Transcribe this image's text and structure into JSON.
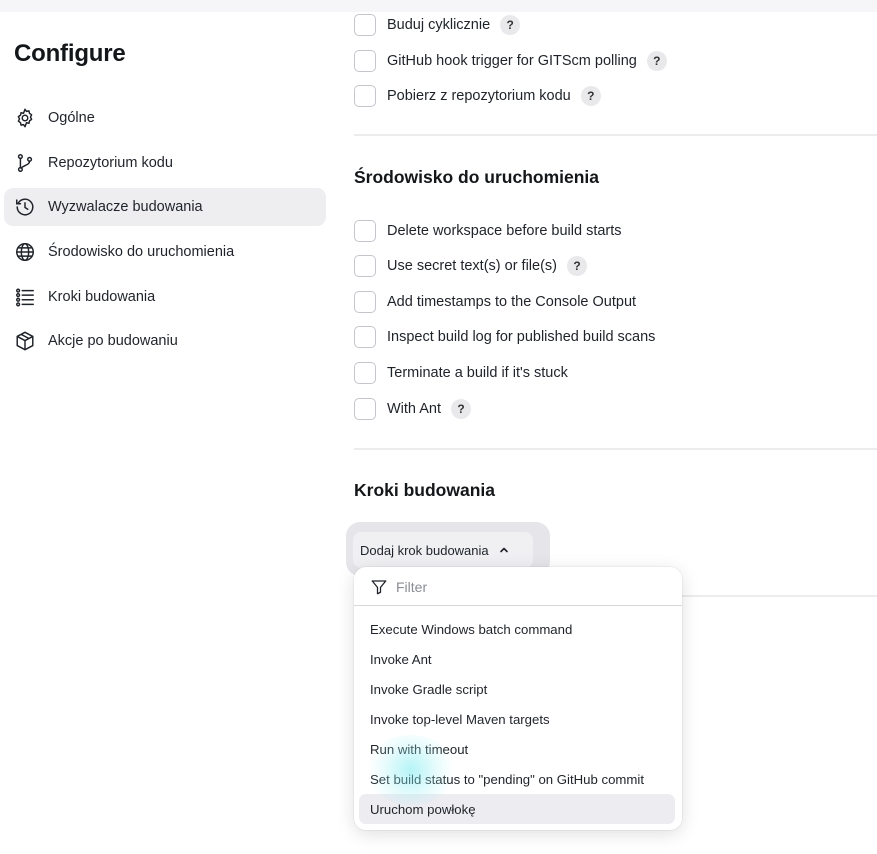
{
  "page_title": "Configure",
  "sidebar": {
    "items": [
      {
        "label": "Ogólne",
        "icon": "gear-icon",
        "active": false
      },
      {
        "label": "Repozytorium kodu",
        "icon": "branch-icon",
        "active": false
      },
      {
        "label": "Wyzwalacze budowania",
        "icon": "clock-icon",
        "active": true
      },
      {
        "label": "Środowisko do uruchomienia",
        "icon": "globe-icon",
        "active": false
      },
      {
        "label": "Kroki budowania",
        "icon": "list-icon",
        "active": false
      },
      {
        "label": "Akcje po budowaniu",
        "icon": "package-icon",
        "active": false
      }
    ]
  },
  "triggers": {
    "options": [
      {
        "label": "Buduj cyklicznie",
        "help": "?"
      },
      {
        "label": "GitHub hook trigger for GITScm polling",
        "help": "?"
      },
      {
        "label": "Pobierz z repozytorium kodu",
        "help": "?"
      }
    ]
  },
  "environment": {
    "title": "Środowisko do uruchomienia",
    "options": [
      {
        "label": "Delete workspace before build starts"
      },
      {
        "label": "Use secret text(s) or file(s)",
        "help": "?"
      },
      {
        "label": "Add timestamps to the Console Output"
      },
      {
        "label": "Inspect build log for published build scans"
      },
      {
        "label": "Terminate a build if it's stuck"
      },
      {
        "label": "With Ant",
        "help": "?"
      }
    ]
  },
  "build_steps": {
    "title": "Kroki budowania",
    "add_button_label": "Dodaj krok budowania"
  },
  "dropdown": {
    "filter_placeholder": "Filter",
    "items": [
      "Execute Windows batch command",
      "Invoke Ant",
      "Invoke Gradle script",
      "Invoke top-level Maven targets",
      "Run with timeout",
      "Set build status to \"pending\" on GitHub commit",
      "Uruchom powłokę"
    ],
    "hovered_item": "Uruchom powłokę"
  }
}
